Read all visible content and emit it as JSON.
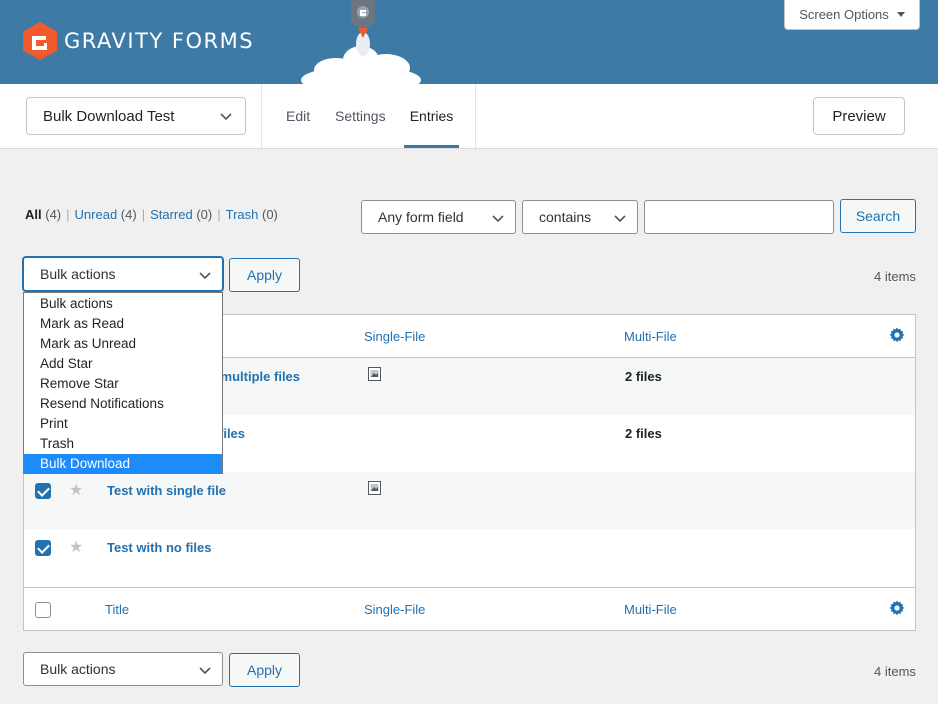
{
  "header": {
    "logo_text": "GRAVITY FORMS",
    "screen_options_label": "Screen Options",
    "brand_color": "#3e7aa6"
  },
  "toolbar": {
    "form_name": "Bulk Download Test",
    "tabs": [
      {
        "label": "Edit",
        "active": false
      },
      {
        "label": "Settings",
        "active": false
      },
      {
        "label": "Entries",
        "active": true
      }
    ],
    "preview_label": "Preview"
  },
  "views": {
    "all": {
      "label": "All",
      "count": "(4)"
    },
    "unread": {
      "label": "Unread",
      "count": "(4)"
    },
    "starred": {
      "label": "Starred",
      "count": "(0)"
    },
    "trash": {
      "label": "Trash",
      "count": "(0)"
    }
  },
  "search": {
    "field_select": "Any form field",
    "operator_select": "contains",
    "query": "",
    "button_label": "Search"
  },
  "bulk_top": {
    "select_value": "Bulk actions",
    "apply_label": "Apply",
    "items_count": "4 items"
  },
  "bulk_dropdown": {
    "options": [
      "Bulk actions",
      "Mark as Read",
      "Mark as Unread",
      "Add Star",
      "Remove Star",
      "Resend Notifications",
      "Print",
      "Trash",
      "Bulk Download"
    ],
    "highlighted": "Bulk Download"
  },
  "table": {
    "columns": {
      "title": "Title",
      "single_file": "Single-File",
      "multi_file": "Multi-File"
    },
    "rows": [
      {
        "title_visible": "d multiple files",
        "single_file_icon": "image-file-icon",
        "multi_file": "2 files",
        "checked": true,
        "starred": false
      },
      {
        "title_visible": "files",
        "single_file_icon": "",
        "multi_file": "2 files",
        "checked": true,
        "starred": false
      },
      {
        "title_visible": "Test with single file",
        "single_file_icon": "image-file-icon",
        "multi_file": "",
        "checked": true,
        "starred": false
      },
      {
        "title_visible": "Test with no files",
        "single_file_icon": "",
        "multi_file": "",
        "checked": true,
        "starred": false
      }
    ]
  },
  "bulk_bottom": {
    "select_value": "Bulk actions",
    "apply_label": "Apply",
    "items_count": "4 items"
  }
}
